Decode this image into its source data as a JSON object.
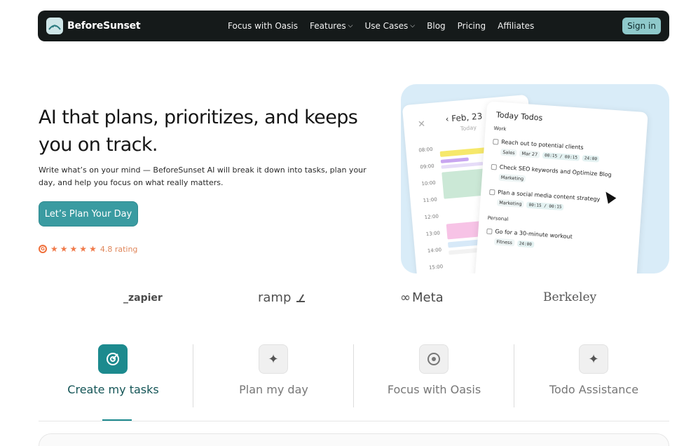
{
  "nav": {
    "logo_text": "BeforeSunset",
    "links": [
      {
        "label": "Focus with Oasis",
        "has_dropdown": false
      },
      {
        "label": "Features",
        "has_dropdown": true
      },
      {
        "label": "Use Cases",
        "has_dropdown": true
      },
      {
        "label": "Blog",
        "has_dropdown": false
      },
      {
        "label": "Pricing",
        "has_dropdown": false
      },
      {
        "label": "Affiliates",
        "has_dropdown": false
      }
    ],
    "signin_label": "Sign in"
  },
  "hero": {
    "title": "AI that plans, prioritizes, and keeps you on track.",
    "subtitle": "Write what’s on your mind — BeforeSunset AI will break it down into tasks, plan your day, and help you focus on what really matters.",
    "cta_label": "Let’s Plan Your Day",
    "rating_text": "4.8 rating",
    "rating_stars": 5
  },
  "hero_art": {
    "calendar": {
      "date": "Feb, 23",
      "today": "Today",
      "times": [
        "08:00",
        "09:00",
        "10:00",
        "11:00",
        "12:00",
        "13:00",
        "14:00",
        "15:00"
      ]
    },
    "todos": {
      "title": "Today Todos",
      "sections": [
        {
          "name": "Work",
          "items": [
            {
              "text": "Reach out to potential clients",
              "tags": [
                "Sales",
                "Mar 27"
              ],
              "times": [
                "00:15 / 00:15",
                "24:00"
              ]
            },
            {
              "text": "Check SEO keywords and Optimize Blog",
              "tags": [
                "Marketing"
              ],
              "times": []
            },
            {
              "text": "Plan a social media content strategy",
              "tags": [
                "Marketing"
              ],
              "times": [
                "00:15 / 00:15"
              ]
            }
          ]
        },
        {
          "name": "Personal",
          "items": [
            {
              "text": "Go for a 30-minute workout",
              "tags": [
                "Fitness"
              ],
              "times": [
                "24:00"
              ]
            }
          ]
        }
      ]
    }
  },
  "logos": [
    "_zapier",
    "ramp",
    "Meta",
    "Berkeley"
  ],
  "tabs": [
    {
      "label": "Create my tasks",
      "icon": "target-icon",
      "active": true
    },
    {
      "label": "Plan my day",
      "icon": "sparkle-icon",
      "active": false
    },
    {
      "label": "Focus with Oasis",
      "icon": "focus-icon",
      "active": false
    },
    {
      "label": "Todo Assistance",
      "icon": "sparkle-icon",
      "active": false
    }
  ],
  "colors": {
    "nav_bg": "#151a1a",
    "accent": "#3a9ba1",
    "signin_bg": "#8fc9cb",
    "rating": "#f07a4a",
    "hero_art_bg": "#d9ecf8"
  }
}
